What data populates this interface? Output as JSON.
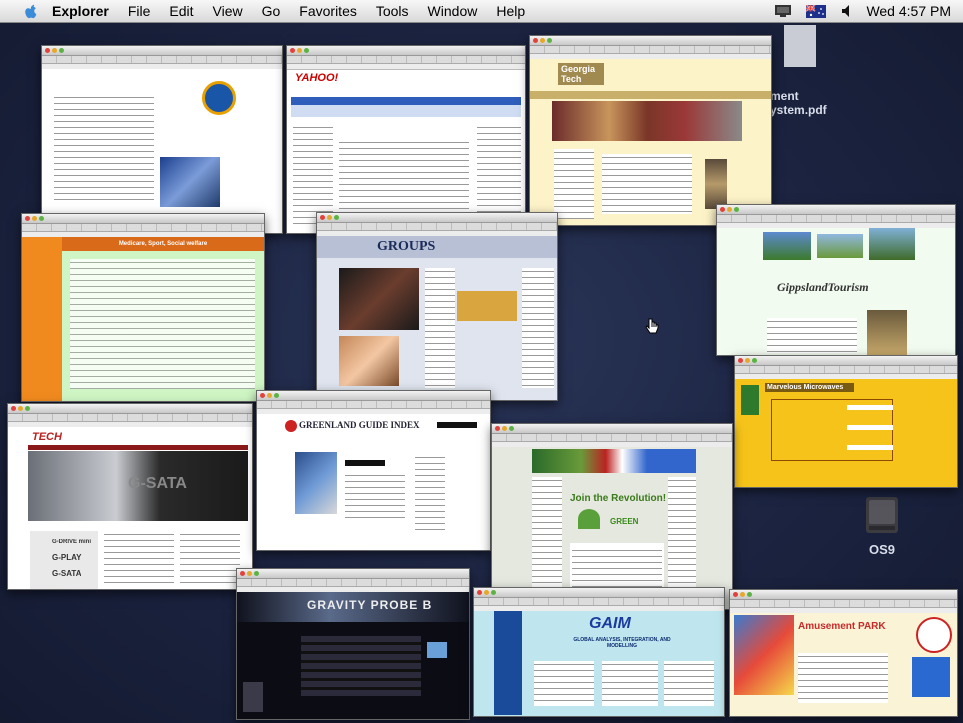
{
  "menubar": {
    "items": [
      "Explorer",
      "File",
      "Edit",
      "View",
      "Go",
      "Favorites",
      "Tools",
      "Window",
      "Help"
    ],
    "clock": "Wed 4:57 PM"
  },
  "desktop": {
    "file_icon_label": "ment\nystem.pdf",
    "disk_icon_label": "OS9"
  },
  "windows": {
    "yahoo_logo": "YAHOO!",
    "georgia_tech": "Georgia Tech",
    "orange_header": "Medicare, Sport, Social welfare",
    "groups": "GROUPS",
    "gippsland": "GippslandTourism",
    "marvelous": "Marvelous Microwaves",
    "gtech_logo": "TECH",
    "gsata": "G-SATA",
    "gdrive": "G-DRIVE mini",
    "gplay": "G-PLAY",
    "gsata2": "G-SATA",
    "greenland": "GREENLAND GUIDE INDEX",
    "join": "Join the Revolution!",
    "green": "GREEN",
    "gravity": "GRAVITY PROBE B",
    "gaim": "GAIM",
    "gaim_sub": "GLOBAL ANALYSIS, INTEGRATION, AND MODELLING",
    "park": "Amusement PARK"
  }
}
